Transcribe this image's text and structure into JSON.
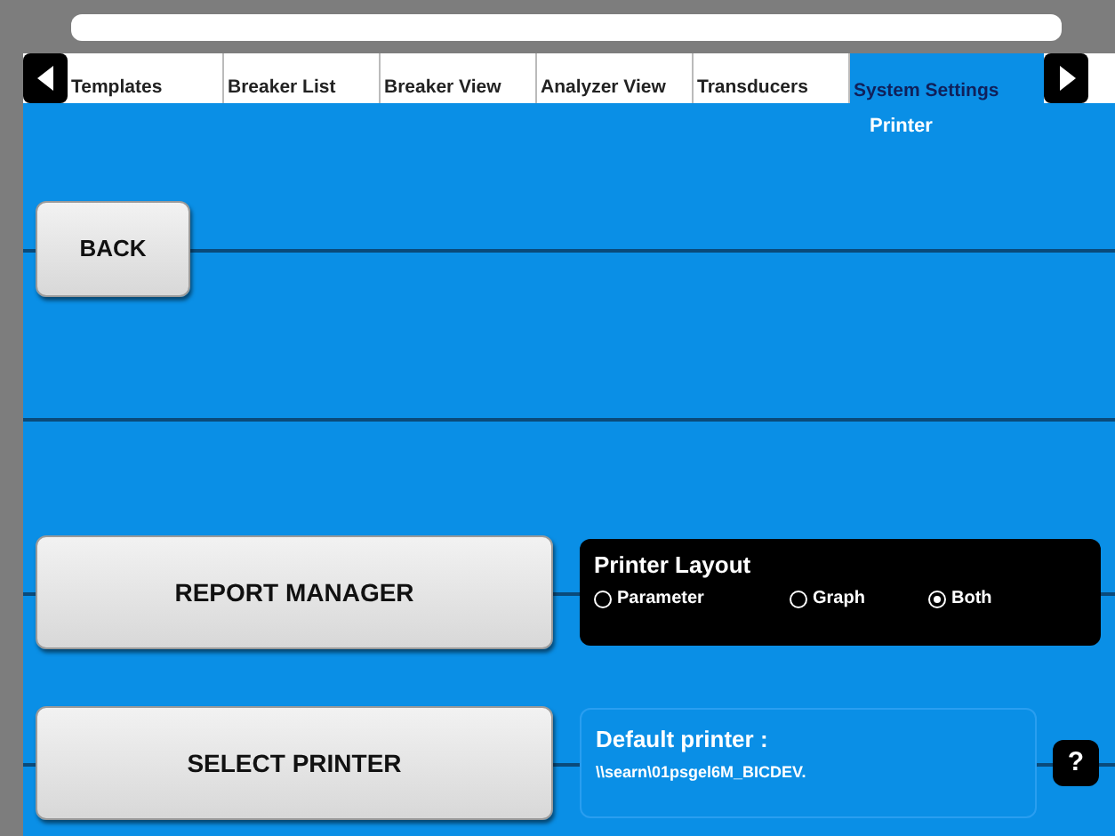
{
  "tabs": [
    {
      "label": "Templates",
      "selected": false
    },
    {
      "label": "Breaker List",
      "selected": false
    },
    {
      "label": "Breaker View",
      "selected": false
    },
    {
      "label": "Analyzer View",
      "selected": false
    },
    {
      "label": "Transducers",
      "selected": false
    },
    {
      "label": "System Settings",
      "selected": true,
      "subtitle": "Printer"
    }
  ],
  "back_button": "BACK",
  "report_manager_button": "REPORT MANAGER",
  "printer_layout": {
    "title": "Printer Layout",
    "options": [
      {
        "label": "Parameter",
        "selected": false
      },
      {
        "label": "Graph",
        "selected": false
      },
      {
        "label": "Both",
        "selected": true
      }
    ]
  },
  "select_printer_button": "SELECT PRINTER",
  "default_printer": {
    "title": "Default printer :",
    "value": "\\\\searn\\01psgel6M_BICDEV."
  },
  "help_button": "?"
}
